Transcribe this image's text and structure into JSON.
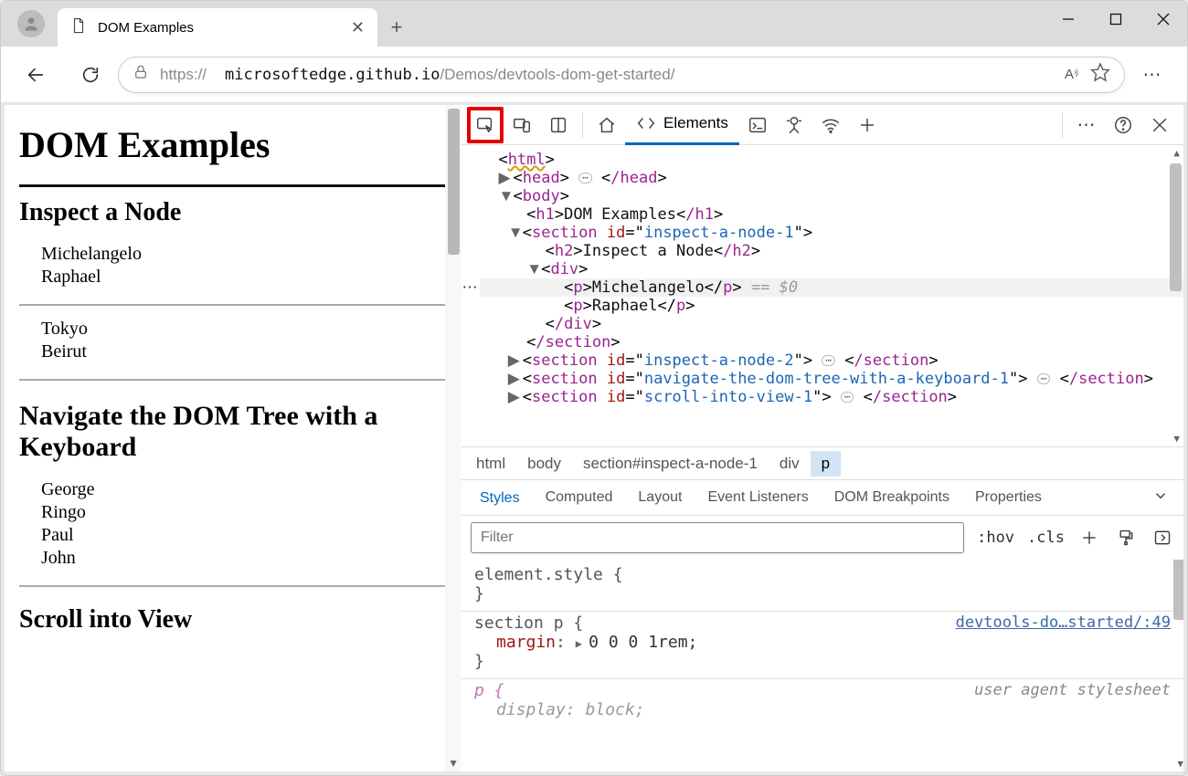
{
  "window": {
    "tab_title": "DOM Examples",
    "url_proto": "https://",
    "url_domain": "microsoftedge.github.io",
    "url_path": "/Demos/devtools-dom-get-started/"
  },
  "page": {
    "h1": "DOM Examples",
    "s1_title": "Inspect a Node",
    "s1_items": [
      "Michelangelo",
      "Raphael"
    ],
    "s1b_items": [
      "Tokyo",
      "Beirut"
    ],
    "s2_title": "Navigate the DOM Tree with a Keyboard",
    "s2_items": [
      "George",
      "Ringo",
      "Paul",
      "John"
    ],
    "s3_title": "Scroll into View"
  },
  "devtools": {
    "active_tab": "Elements",
    "dom": {
      "html": "html",
      "head_open": "head",
      "head_close": "/head",
      "body": "body",
      "h1_open": "h1",
      "h1_text": "DOM Examples",
      "h1_close": "/h1",
      "sect": "section",
      "sect_id_attr": "id",
      "sect1_id": "inspect-a-node-1",
      "h2_open": "h2",
      "h2_text": "Inspect a Node",
      "h2_close": "/h2",
      "div": "div",
      "p": "p",
      "p1_text": "Michelangelo",
      "p2_text": "Raphael",
      "eq0": " == $0",
      "sect2_id": "inspect-a-node-2",
      "sect3_id": "navigate-the-dom-tree-with-a-keyboard-1",
      "sect4_id": "scroll-into-view-1",
      "close_section": "/section",
      "close_div": "/div"
    },
    "breadcrumb": [
      "html",
      "body",
      "section#inspect-a-node-1",
      "div",
      "p"
    ],
    "styles_tabs": [
      "Styles",
      "Computed",
      "Layout",
      "Event Listeners",
      "DOM Breakpoints",
      "Properties"
    ],
    "filter_placeholder": "Filter",
    "hov": ":hov",
    "cls": ".cls",
    "styles": {
      "elstyle": "element.style {",
      "r1_sel": "section p {",
      "r1_prop": "margin",
      "r1_val": "0 0 0 1rem;",
      "r1_src": "devtools-do…started/:49",
      "r2_sel": "p {",
      "r2_prop": "display",
      "r2_val": "block;",
      "r2_ua": "user agent stylesheet",
      "brace_close": "}"
    }
  }
}
